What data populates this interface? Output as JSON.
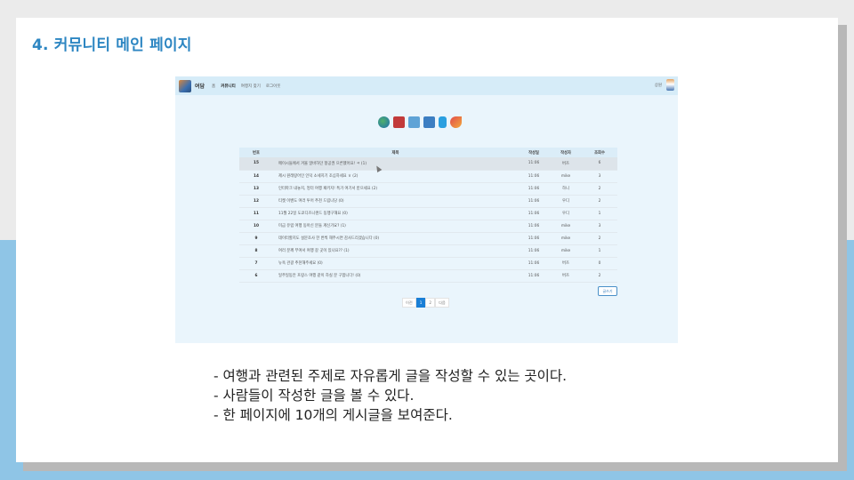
{
  "slide": {
    "title": "4. 커뮤니티 메인 페이지",
    "bullets": [
      "- 여행과 관련된 주제로 자유롭게 글을 작성할 수 있는 곳이다.",
      "- 사람들이 작성한 글을 볼 수 있다.",
      "- 한 페이지에 10개의 게시글을 보여준다."
    ]
  },
  "nav": {
    "brand": "여담",
    "links": [
      "홈",
      "커뮤니티",
      "여행지 찾기",
      "로그아웃"
    ],
    "user": "상원"
  },
  "emojis": [
    "globe-icon",
    "train-icon",
    "airplane-icon",
    "airplane-landing-icon",
    "luggage-icon",
    "rocket-icon"
  ],
  "board": {
    "headers": [
      "번호",
      "제목",
      "작성일",
      "작성자",
      "조회수"
    ],
    "rows": [
      {
        "no": "15",
        "title": "메이시들에서 겨울 알바하던 항공권 으른했어요! ㅋ (1)",
        "date": "11:06",
        "author": "버즈",
        "views": "6"
      },
      {
        "no": "14",
        "title": "제시 원래랑어인 인덕 소세지기 조심하세요 ㅎ (2)",
        "date": "11:06",
        "author": "mike",
        "views": "3"
      },
      {
        "no": "13",
        "title": "인터파크 내놓지, 엉터 여행 패키지! 특가 여기서 받으세요 (2)",
        "date": "11:06",
        "author": "하니",
        "views": "2"
      },
      {
        "no": "12",
        "title": "티켓 이벤도 여러 투어 추천 드립니당 (0)",
        "date": "11:06",
        "author": "우디",
        "views": "2"
      },
      {
        "no": "11",
        "title": "11월 22일 도쿄디즈니랜드 동행구해요 (0)",
        "date": "11:06",
        "author": "우디",
        "views": "1"
      },
      {
        "no": "10",
        "title": "미급 유럽 여행 동아신 분들 계신가요? (1)",
        "date": "11:06",
        "author": "mike",
        "views": "3"
      },
      {
        "no": "9",
        "title": "데이터할지도 설문조사 한 번씩 해주시면 감사드리겠습니다 (0)",
        "date": "11:06",
        "author": "mike",
        "views": "2"
      },
      {
        "no": "8",
        "title": "여러 분께 부여서 여행 갈 곳이 있나요?? (1)",
        "date": "11:06",
        "author": "mike",
        "views": "1"
      },
      {
        "no": "7",
        "title": "뉴욕 관광 추천해주세요 (0)",
        "date": "11:06",
        "author": "버즈",
        "views": "0"
      },
      {
        "no": "6",
        "title": "일주일동안 프랑스 여행 같이 하실 분 구합니다! (0)",
        "date": "11:06",
        "author": "버즈",
        "views": "2"
      }
    ],
    "write_label": "글쓰기"
  },
  "pager": {
    "prev": "이전",
    "pages": [
      "1",
      "2"
    ],
    "next": "다음"
  }
}
